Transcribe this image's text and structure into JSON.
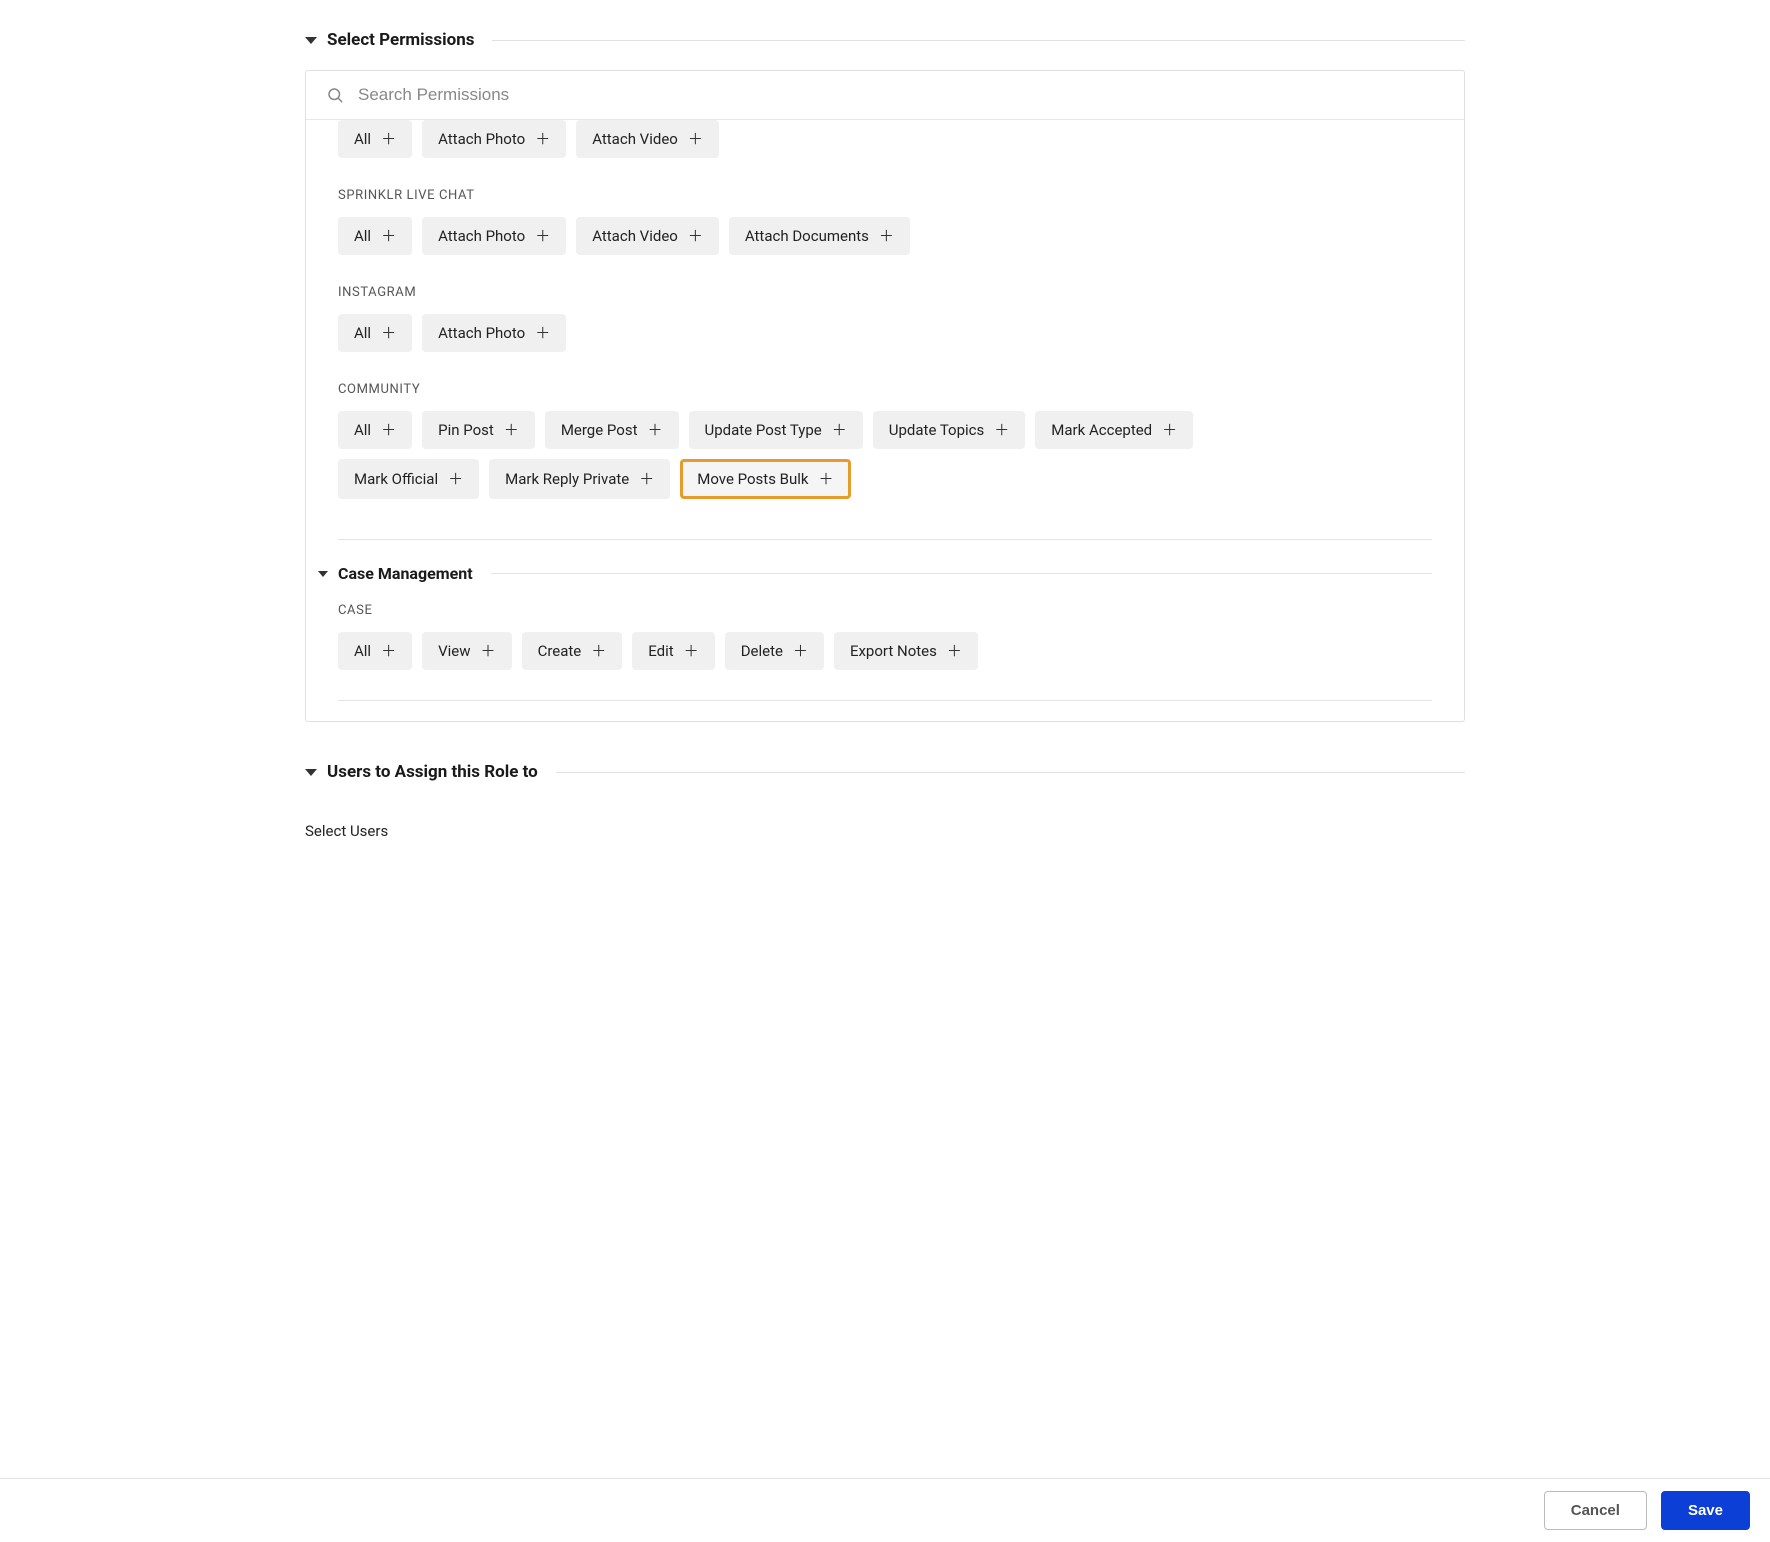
{
  "sections": {
    "select_permissions": {
      "title": "Select Permissions"
    },
    "users_assign": {
      "title": "Users to Assign this Role to"
    },
    "case_management": {
      "title": "Case Management"
    }
  },
  "search": {
    "placeholder": "Search Permissions"
  },
  "groups": {
    "top": {
      "chips": [
        "All",
        "Attach Photo",
        "Attach Video"
      ]
    },
    "sprinklr_live_chat": {
      "label": "SPRINKLR LIVE CHAT",
      "chips": [
        "All",
        "Attach Photo",
        "Attach Video",
        "Attach Documents"
      ]
    },
    "instagram": {
      "label": "INSTAGRAM",
      "chips": [
        "All",
        "Attach Photo"
      ]
    },
    "community": {
      "label": "COMMUNITY",
      "chips_row1": [
        "All",
        "Pin Post",
        "Merge Post",
        "Update Post Type",
        "Update Topics",
        "Mark Accepted"
      ],
      "chips_row2": [
        "Mark Official",
        "Mark Reply Private",
        "Move Posts Bulk"
      ],
      "highlighted": "Move Posts Bulk"
    },
    "case": {
      "label": "CASE",
      "chips": [
        "All",
        "View",
        "Create",
        "Edit",
        "Delete",
        "Export Notes"
      ]
    }
  },
  "select_users_label": "Select Users",
  "footer": {
    "cancel": "Cancel",
    "save": "Save"
  }
}
